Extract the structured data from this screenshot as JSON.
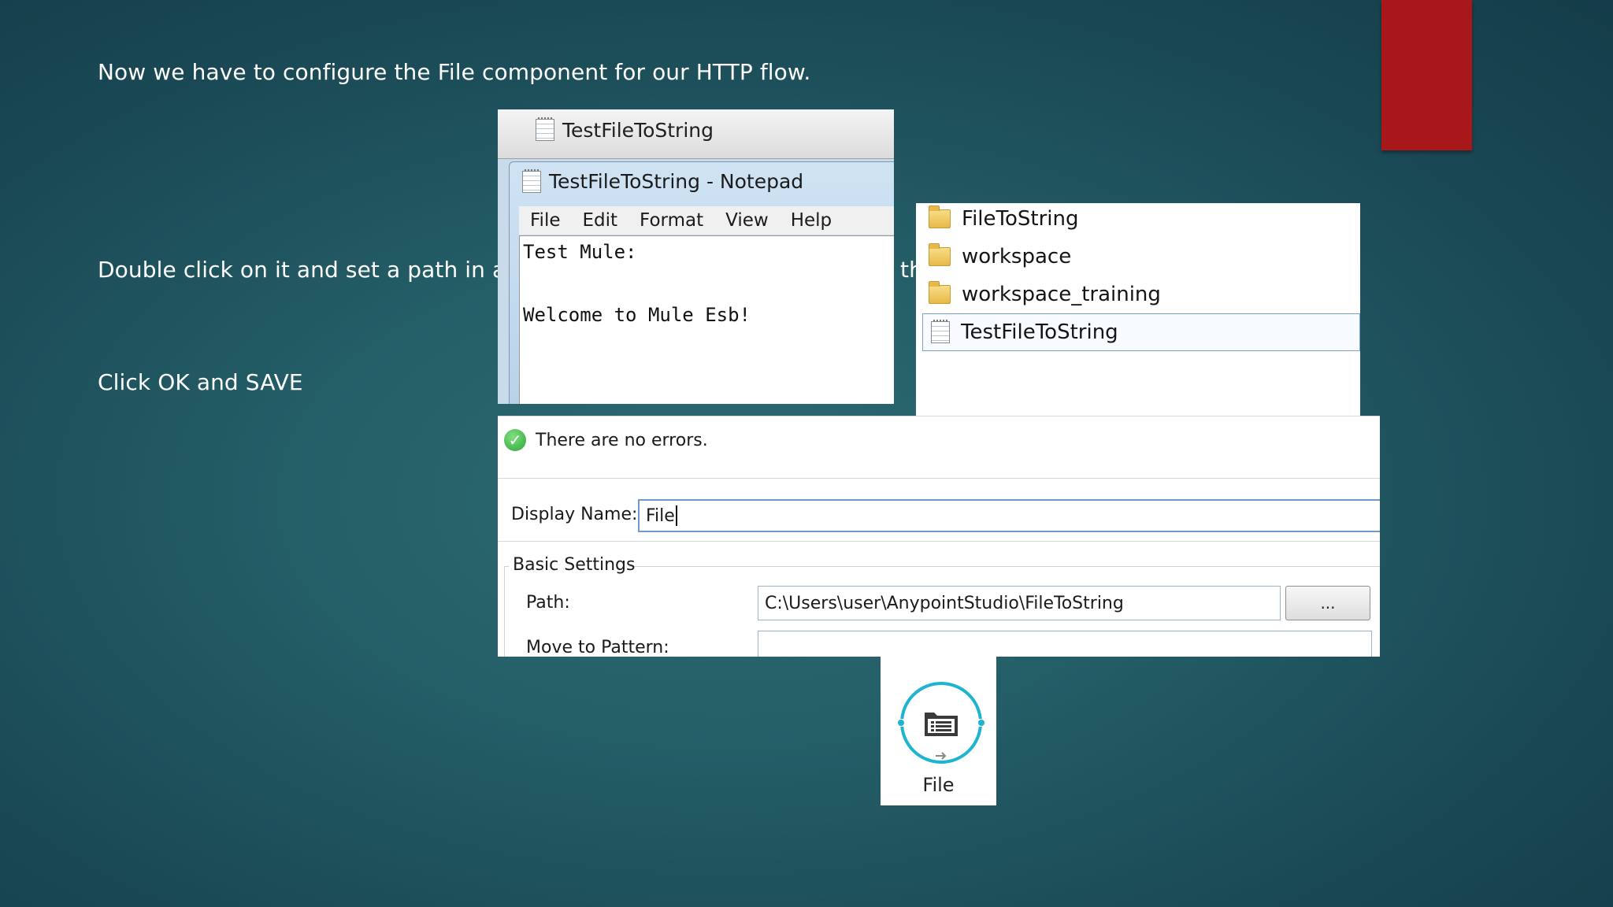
{
  "slide": {
    "line1": "Now we have to configure  the File component for our HTTP flow.",
    "line2": "Double click on it and set a path in a lo",
    "line2_tail": "th",
    "line3": "Click OK and SAVE"
  },
  "notepad": {
    "taskbar_tab": "TestFileToString",
    "window_title": "TestFileToString - Notepad",
    "menu": [
      "File",
      "Edit",
      "Format",
      "View",
      "Help"
    ],
    "content_lines": [
      "Test Mule:",
      "",
      "Welcome to Mule Esb!"
    ]
  },
  "explorer": {
    "items": [
      {
        "label": "FileToString",
        "icon": "folder-icon"
      },
      {
        "label": "workspace",
        "icon": "folder-icon"
      },
      {
        "label": "workspace_training",
        "icon": "folder-icon"
      },
      {
        "label": "TestFileToString",
        "icon": "text-file-icon"
      }
    ]
  },
  "properties": {
    "status": "There are no errors.",
    "display_name_label": "Display Name:",
    "display_name_value": "File",
    "group_title": "Basic Settings",
    "path_label": "Path:",
    "path_value": "C:\\Users\\user\\AnypointStudio\\FileToString",
    "browse_label": "...",
    "move_pattern_label": "Move to Pattern:"
  },
  "component": {
    "label": "File",
    "icon": "file-connector-icon"
  },
  "colors": {
    "accent_red": "#a8171a",
    "mule_blue": "#1db3d1",
    "background": "#245e67"
  }
}
